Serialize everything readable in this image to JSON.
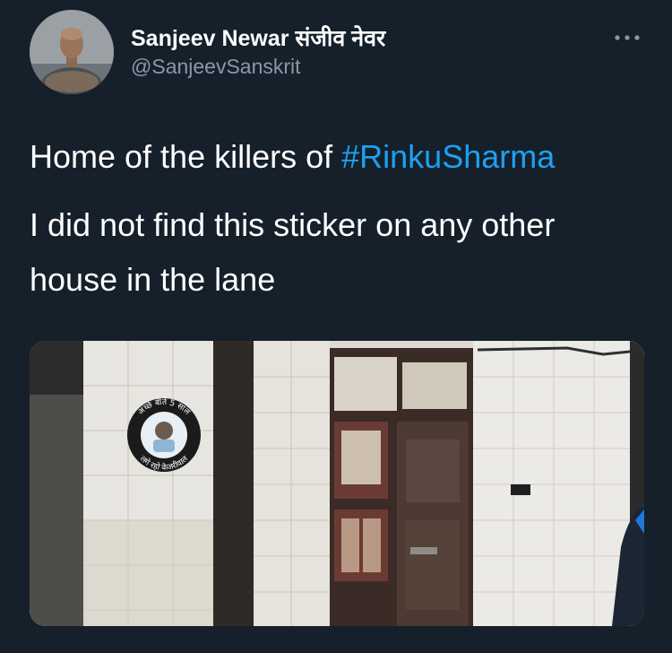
{
  "author": {
    "display_name": "Sanjeev Newar संजीव नेवर",
    "handle": "@SanjeevSanskrit",
    "avatar_icon": "user-avatar-photo"
  },
  "tweet": {
    "line1_text": "Home of the killers of ",
    "line1_hashtag": "#RinkuSharma",
    "line2": "I did not find this sticker on any other",
    "line3": "house in the lane"
  },
  "media": {
    "sticker_top_text": "अच्छे बीते 5 साल",
    "sticker_bottom_text": "लगे रहो केजरीवाल"
  },
  "colors": {
    "background": "#15202b",
    "text": "#ffffff",
    "secondary_text": "#8899a6",
    "link": "#1da1f2"
  }
}
